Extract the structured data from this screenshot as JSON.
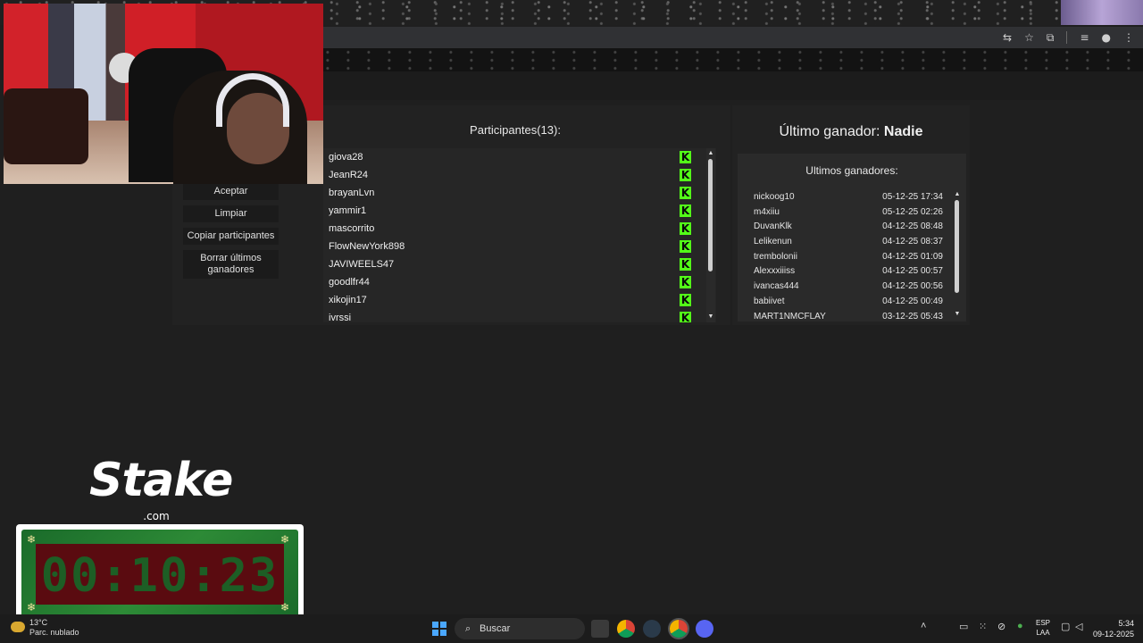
{
  "browser": {
    "toolbar_icons": [
      "translate-icon",
      "star-icon",
      "extensions-icon",
      "media-icon",
      "profile-icon",
      "menu-icon"
    ],
    "toolbar_glyphs": [
      "⇆",
      "☆",
      "⧉",
      "≡",
      "●",
      "⋮"
    ]
  },
  "controls": {
    "accept_label": "Aceptar",
    "clear_label": "Limpiar",
    "copy_label": "Copiar participantes",
    "delete_winners_label": "Borrar últimos ganadores"
  },
  "participants": {
    "title": "Participantes(13):",
    "platform_icon_glyph": "K",
    "items": [
      "giova28",
      "JeanR24",
      "brayanLvn",
      "yammir1",
      "mascorrito",
      "FlowNewYork898",
      "JAVIWEELS47",
      "goodlfr44",
      "xikojin17",
      "ivrssi"
    ]
  },
  "last_winner": {
    "label": "Último ganador:",
    "name": "Nadie"
  },
  "winners": {
    "title": "Ultimos ganadores:",
    "items": [
      {
        "name": "nickoog10",
        "date": "05-12-25 17:34"
      },
      {
        "name": "m4xiiu",
        "date": "05-12-25 02:26"
      },
      {
        "name": "DuvanKlk",
        "date": "04-12-25 08:48"
      },
      {
        "name": "Lelikenun",
        "date": "04-12-25 08:37"
      },
      {
        "name": "trembolonii",
        "date": "04-12-25 01:09"
      },
      {
        "name": "Alexxxiiiss",
        "date": "04-12-25 00:57"
      },
      {
        "name": "ivancas444",
        "date": "04-12-25 00:56"
      },
      {
        "name": "babiivet",
        "date": "04-12-25 00:49"
      },
      {
        "name": "MART1NMCFLAY",
        "date": "03-12-25 05:43"
      }
    ]
  },
  "overlay": {
    "brand": "Stake",
    "brand_suffix": ".com",
    "timer": "00:10:23"
  },
  "taskbar": {
    "weather_temp": "13°C",
    "weather_desc": "Parc. nublado",
    "search_label": "Buscar",
    "lang_top": "ESP",
    "lang_bottom": "LAA",
    "time": "5:34",
    "date": "09-12-2025"
  },
  "colors": {
    "kick_green": "#53fc18",
    "panel_bg": "#222222",
    "page_bg": "#1f1f1f"
  }
}
